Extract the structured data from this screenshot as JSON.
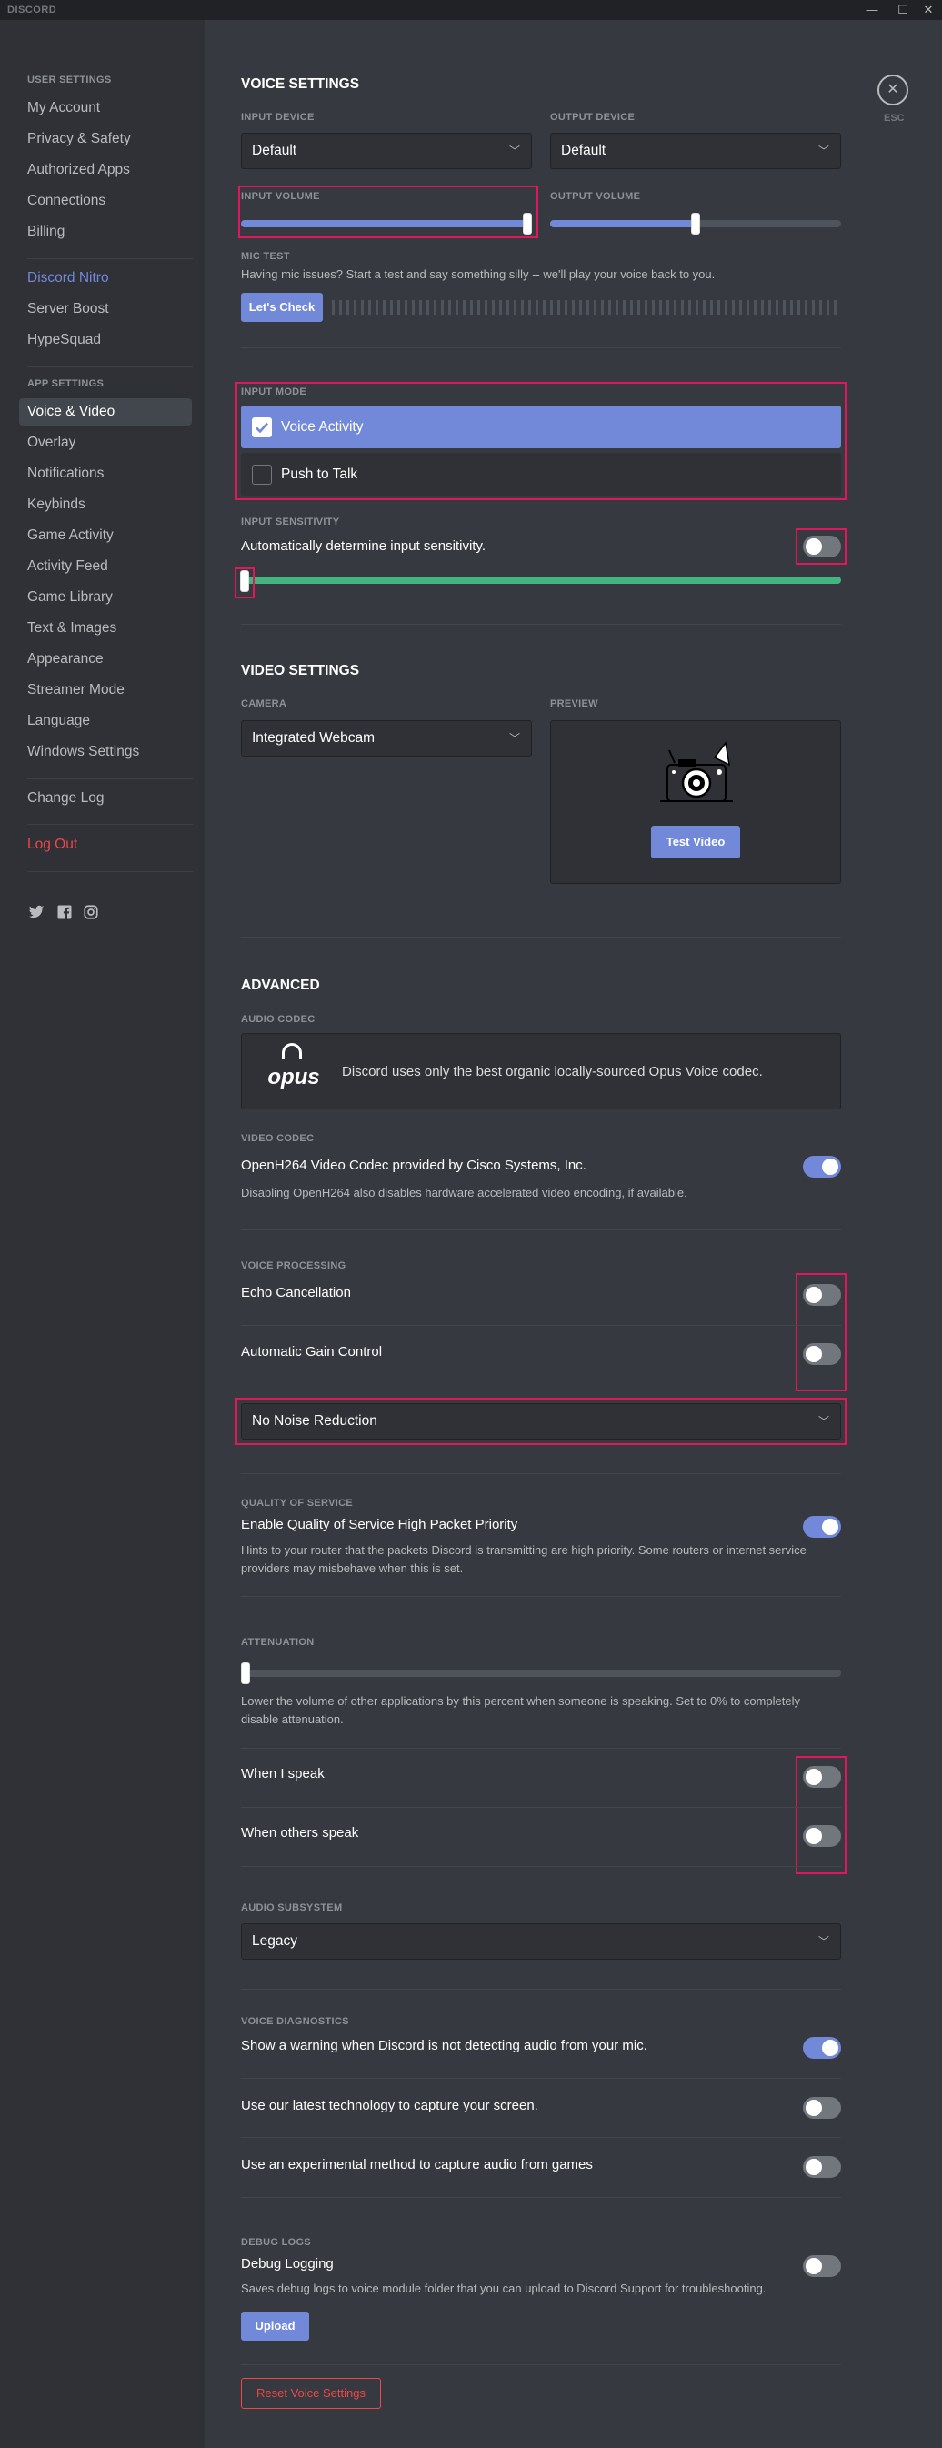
{
  "app": {
    "logo": "DISCORD"
  },
  "window": {
    "min": "—",
    "max": "☐",
    "close": "✕"
  },
  "sidebar": {
    "user_settings_header": "USER SETTINGS",
    "user_items": [
      "My Account",
      "Privacy & Safety",
      "Authorized Apps",
      "Connections",
      "Billing"
    ],
    "nitro": "Discord Nitro",
    "server_boost": "Server Boost",
    "hypesquad": "HypeSquad",
    "app_settings_header": "APP SETTINGS",
    "app_items": [
      "Voice & Video",
      "Overlay",
      "Notifications",
      "Keybinds",
      "Game Activity",
      "Activity Feed",
      "Game Library",
      "Text & Images",
      "Appearance",
      "Streamer Mode",
      "Language",
      "Windows Settings"
    ],
    "change_log": "Change Log",
    "log_out": "Log Out",
    "social_icons": [
      "twitter-icon",
      "facebook-icon",
      "instagram-icon"
    ]
  },
  "close": {
    "label": "ESC",
    "icon": "close-icon"
  },
  "voice": {
    "title": "VOICE SETTINGS",
    "input_device_label": "INPUT DEVICE",
    "input_device": "Default",
    "output_device_label": "OUTPUT DEVICE",
    "output_device": "Default",
    "input_volume_label": "INPUT VOLUME",
    "input_volume": 1.0,
    "output_volume_label": "OUTPUT VOLUME",
    "output_volume": 0.5,
    "mic_test_label": "MIC TEST",
    "mic_test_desc": "Having mic issues? Start a test and say something silly -- we'll play your voice back to you.",
    "lets_check": "Let's Check",
    "input_mode_label": "INPUT MODE",
    "voice_activity": "Voice Activity",
    "push_to_talk": "Push to Talk",
    "input_mode_selected": "Voice Activity",
    "sensitivity_label": "INPUT SENSITIVITY",
    "auto_sensitivity": "Automatically determine input sensitivity.",
    "auto_sensitivity_on": false,
    "sensitivity_color": "#43b581"
  },
  "video": {
    "title": "VIDEO SETTINGS",
    "camera_label": "CAMERA",
    "camera": "Integrated Webcam",
    "preview_label": "PREVIEW",
    "test_video": "Test Video"
  },
  "advanced": {
    "title": "ADVANCED",
    "audio_codec_label": "AUDIO CODEC",
    "opus_logo": "opus",
    "opus_text": "Discord uses only the best organic locally-sourced Opus Voice codec.",
    "video_codec_label": "VIDEO CODEC",
    "openh264_title": "OpenH264 Video Codec provided by Cisco Systems, Inc.",
    "openh264_desc": "Disabling OpenH264 also disables hardware accelerated video encoding, if available.",
    "openh264_on": true,
    "voice_processing_label": "VOICE PROCESSING",
    "echo_cancellation": "Echo Cancellation",
    "echo_on": false,
    "agc": "Automatic Gain Control",
    "agc_on": false,
    "noise_reduction": "No Noise Reduction",
    "qos_label": "QUALITY OF SERVICE",
    "qos_title": "Enable Quality of Service High Packet Priority",
    "qos_desc_1": "Hints to your router that the packets Discord is transmitting are high priority. Some routers or internet service",
    "qos_desc_2": "providers may misbehave when this is set.",
    "qos_on": true,
    "attenuation_label": "ATTENUATION",
    "attenuation_value": 0,
    "attenuation_desc_1": "Lower the volume of other applications by this percent when someone is speaking. Set to 0% to completely",
    "attenuation_desc_2": "disable attenuation.",
    "when_i_speak": "When I speak",
    "when_i_speak_on": false,
    "when_others_speak": "When others speak",
    "when_others_speak_on": false,
    "audio_subsystem_label": "AUDIO SUBSYSTEM",
    "audio_subsystem": "Legacy",
    "voice_diagnostics_label": "VOICE DIAGNOSTICS",
    "diag_warning": "Show a warning when Discord is not detecting audio from your mic.",
    "diag_warning_on": true,
    "capture_screen": "Use our latest technology to capture your screen.",
    "capture_screen_on": false,
    "capture_audio": "Use an experimental method to capture audio from games",
    "capture_audio_on": false,
    "debug_logs_label": "DEBUG LOGS",
    "debug_logging": "Debug Logging",
    "debug_logging_desc": "Saves debug logs to voice module folder that you can upload to Discord Support for troubleshooting.",
    "debug_logging_on": false,
    "upload": "Upload",
    "reset": "Reset Voice Settings"
  },
  "colors": {
    "accent": "#7289da",
    "highlight": "#e0175b",
    "danger": "#f04747"
  }
}
